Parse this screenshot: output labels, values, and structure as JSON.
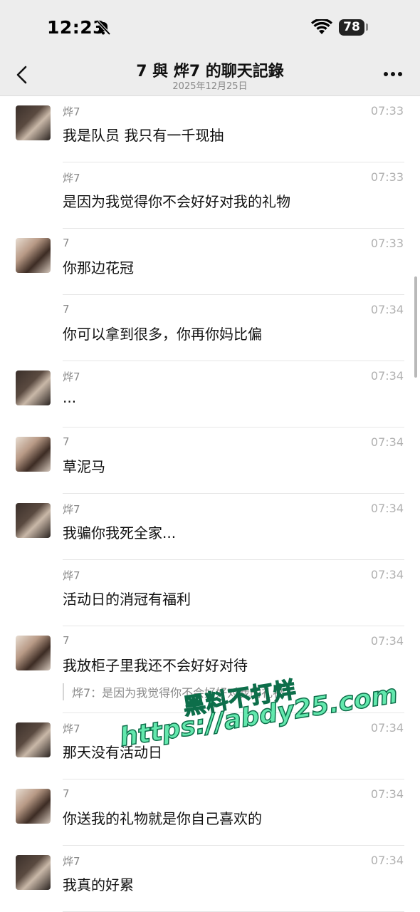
{
  "status_bar": {
    "time": "12:23",
    "battery": "78"
  },
  "header": {
    "title": "7 與 烨7 的聊天記錄",
    "subtitle": "2025年12月25日"
  },
  "messages": [
    {
      "sender": "烨7",
      "time": "07:33",
      "text": "我是队员 我只有一千现抽",
      "avatar": "a"
    },
    {
      "sender": "烨7",
      "time": "07:33",
      "text": "是因为我觉得你不会好好对我的礼物",
      "avatar": ""
    },
    {
      "sender": "7",
      "time": "07:33",
      "text": "你那边花冠",
      "avatar": "b"
    },
    {
      "sender": "7",
      "time": "07:34",
      "text": "你可以拿到很多，你再你妈比偏",
      "avatar": ""
    },
    {
      "sender": "烨7",
      "time": "07:34",
      "text": "...",
      "avatar": "a"
    },
    {
      "sender": "7",
      "time": "07:34",
      "text": "草泥马",
      "avatar": "b"
    },
    {
      "sender": "烨7",
      "time": "07:34",
      "text": "我骗你我死全家...",
      "avatar": "a"
    },
    {
      "sender": "烨7",
      "time": "07:34",
      "text": "活动日的消冠有福利",
      "avatar": ""
    },
    {
      "sender": "7",
      "time": "07:34",
      "text": "我放柜子里我还不会好好对待",
      "avatar": "b",
      "quote": "烨7：是因为我觉得你不会好好对我的礼物"
    },
    {
      "sender": "烨7",
      "time": "07:34",
      "text": "那天没有活动日",
      "avatar": "a"
    },
    {
      "sender": "7",
      "time": "07:34",
      "text": "你送我的礼物就是你自己喜欢的",
      "avatar": "b"
    },
    {
      "sender": "烨7",
      "time": "07:34",
      "text": "我真的好累",
      "avatar": "a"
    }
  ],
  "watermark": {
    "line1": "黑料不打烊",
    "line2": "https://abdy25.com"
  },
  "icons": {
    "back": "chevron-left-icon",
    "more": "ellipsis-icon",
    "mute": "bell-slash-icon",
    "wifi": "wifi-icon"
  }
}
